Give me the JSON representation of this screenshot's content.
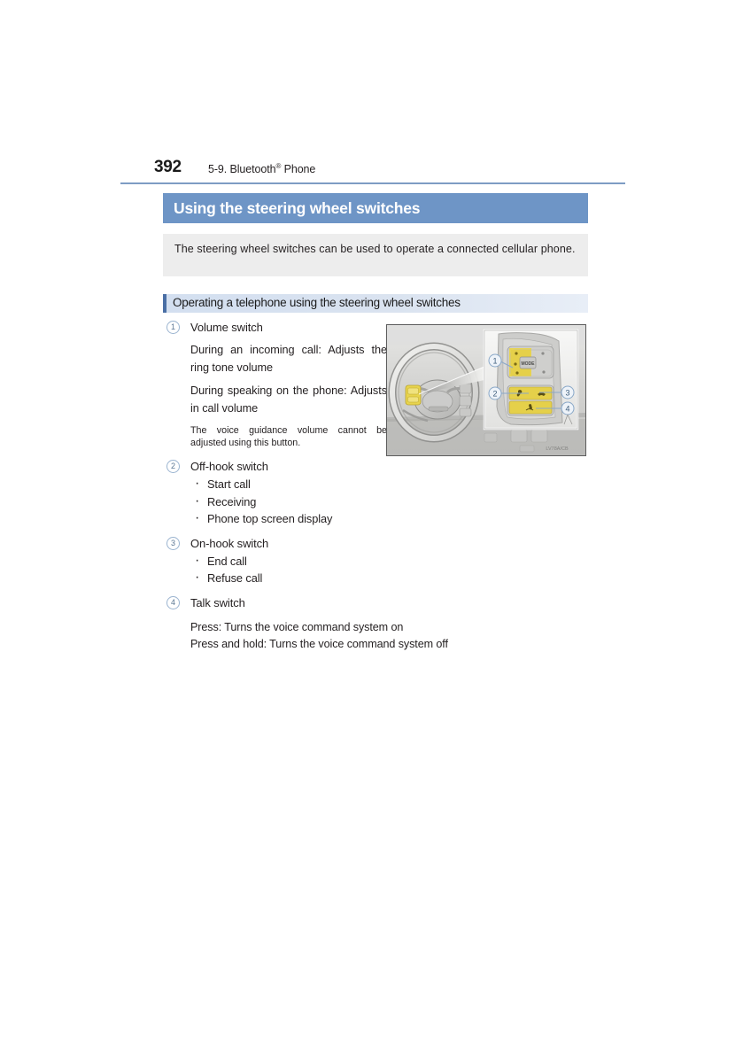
{
  "header": {
    "page_number": "392",
    "breadcrumb_prefix": "5-9. Bluetooth",
    "breadcrumb_mark": "®",
    "breadcrumb_suffix": " Phone"
  },
  "title_bar": {
    "title": "Using the steering wheel switches",
    "color": "#6e95c6"
  },
  "intro": {
    "text": "The steering wheel switches can be used to operate a connected cellular phone.",
    "background": "#ededed"
  },
  "subsection": {
    "title": "Operating a telephone using the steering wheel switches",
    "accent_color": "#4a6fa5",
    "background": "#d9e2ef"
  },
  "items": [
    {
      "number": "1",
      "label": "Volume switch",
      "paragraphs": [
        "During an incoming call: Adjusts the ring tone volume",
        "During speaking on the phone: Adjusts in call volume"
      ],
      "note": "The voice guidance volume cannot be adjusted using this button."
    },
    {
      "number": "2",
      "label": "Off-hook switch",
      "bullets": [
        "Start call",
        "Receiving",
        "Phone top screen display"
      ]
    },
    {
      "number": "3",
      "label": "On-hook switch",
      "bullets": [
        "End call",
        "Refuse call"
      ]
    },
    {
      "number": "4",
      "label": "Talk switch",
      "lines": [
        "Press: Turns the voice command system on",
        "Press and hold: Turns the voice command system off"
      ]
    }
  ],
  "figure": {
    "description": "Steering wheel with inset close-up of switch panel",
    "callouts": [
      "1",
      "2",
      "3",
      "4"
    ],
    "highlight_color": "#e8d44d",
    "watermark": "LV78A/CB"
  }
}
